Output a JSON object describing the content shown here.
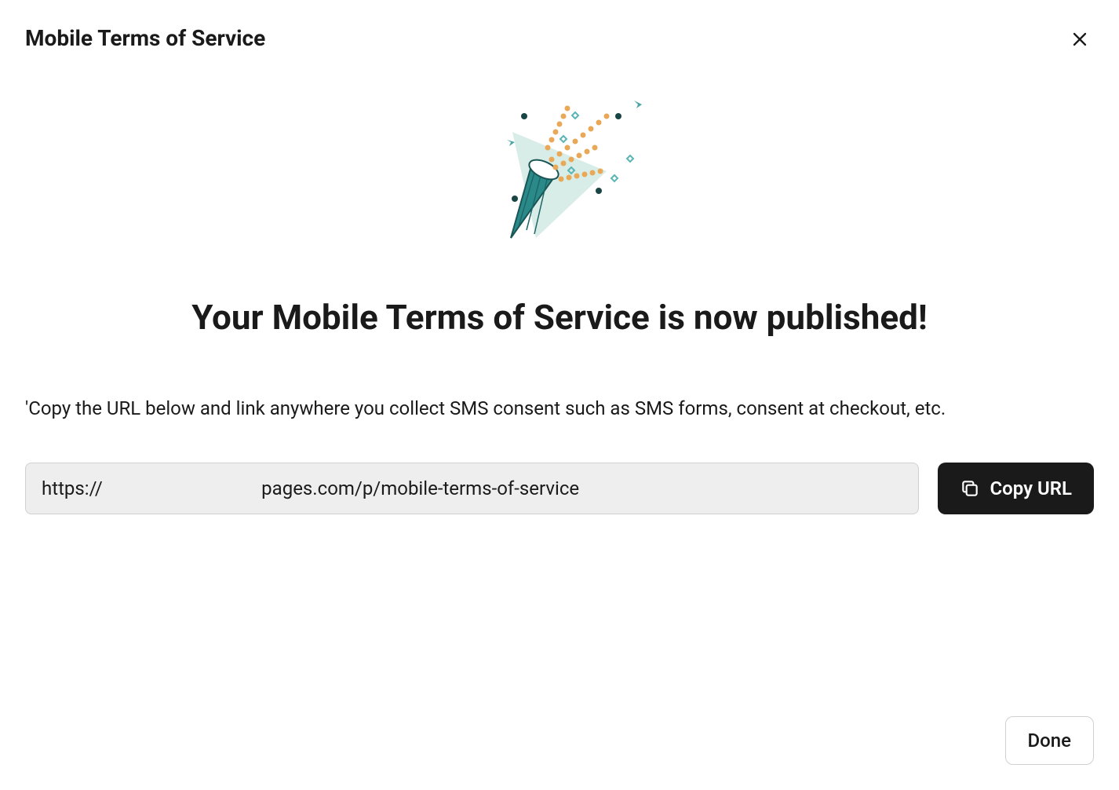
{
  "header": {
    "title": "Mobile Terms of Service"
  },
  "main": {
    "heading": "Your Mobile Terms of Service is now published!",
    "description": "'Copy the URL below and link anywhere you collect SMS consent such as SMS forms, consent at checkout, etc.",
    "url_value": "https://                                  pages.com/p/mobile-terms-of-service",
    "copy_button_label": "Copy URL"
  },
  "footer": {
    "done_button_label": "Done"
  }
}
